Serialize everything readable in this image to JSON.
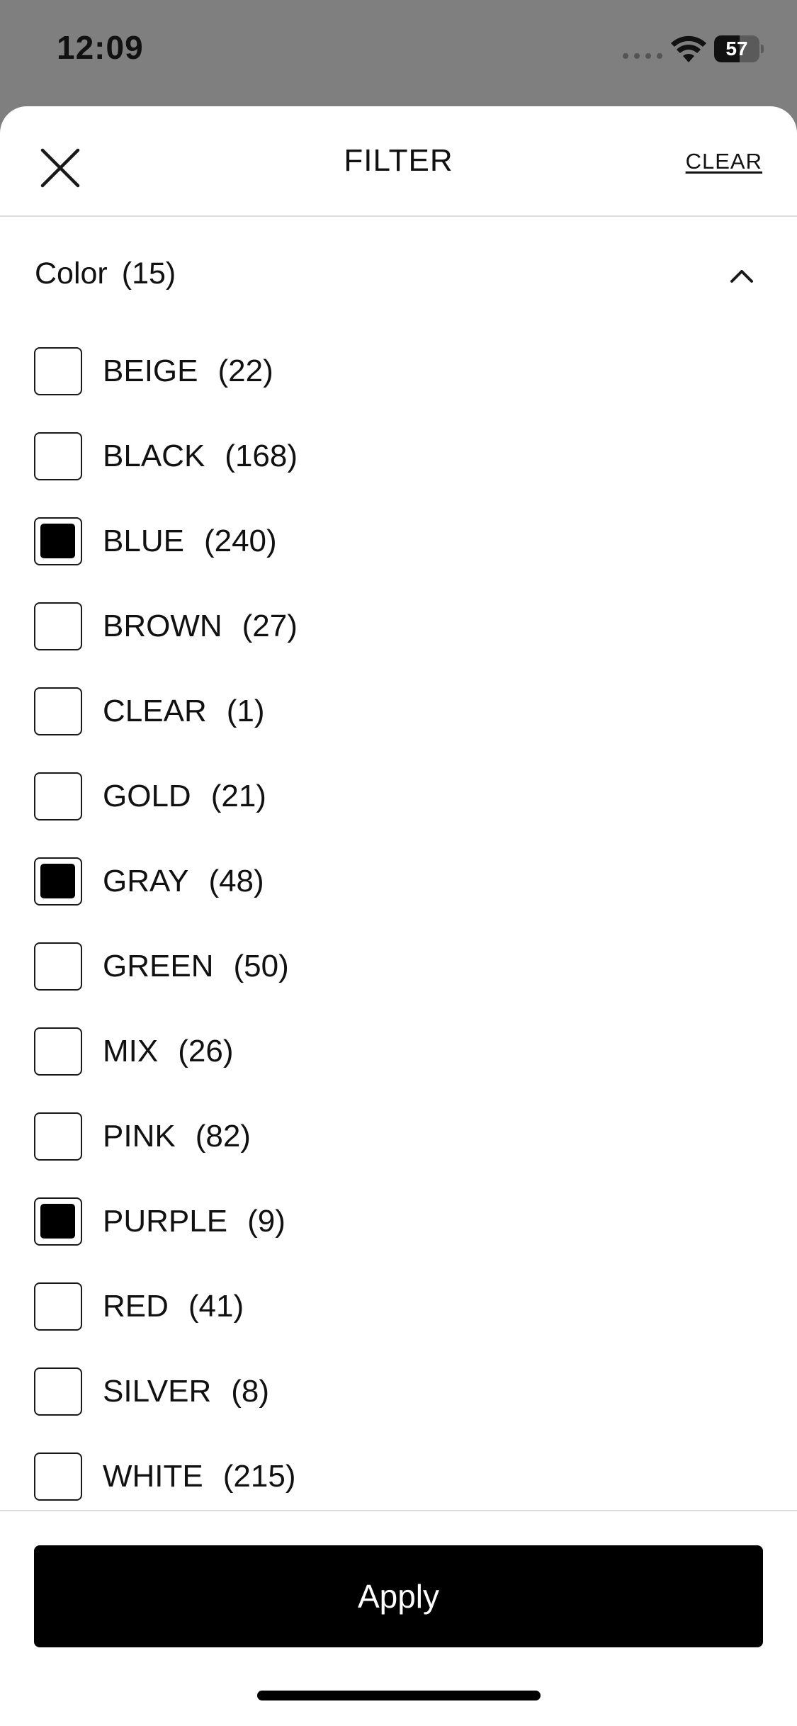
{
  "status_bar": {
    "time": "12:09",
    "battery_level": "57",
    "battery_fraction": 0.57
  },
  "header": {
    "title": "FILTER",
    "clear_label": "CLEAR"
  },
  "section": {
    "title": "Color",
    "count": "(15)",
    "expanded": true
  },
  "options": [
    {
      "label": "BEIGE",
      "count": "(22)",
      "checked": false
    },
    {
      "label": "BLACK",
      "count": "(168)",
      "checked": false
    },
    {
      "label": "BLUE",
      "count": "(240)",
      "checked": true
    },
    {
      "label": "BROWN",
      "count": "(27)",
      "checked": false
    },
    {
      "label": "CLEAR",
      "count": "(1)",
      "checked": false
    },
    {
      "label": "GOLD",
      "count": "(21)",
      "checked": false
    },
    {
      "label": "GRAY",
      "count": "(48)",
      "checked": true
    },
    {
      "label": "GREEN",
      "count": "(50)",
      "checked": false
    },
    {
      "label": "MIX",
      "count": "(26)",
      "checked": false
    },
    {
      "label": "PINK",
      "count": "(82)",
      "checked": false
    },
    {
      "label": "PURPLE",
      "count": "(9)",
      "checked": true
    },
    {
      "label": "RED",
      "count": "(41)",
      "checked": false
    },
    {
      "label": "SILVER",
      "count": "(8)",
      "checked": false
    },
    {
      "label": "WHITE",
      "count": "(215)",
      "checked": false
    }
  ],
  "footer": {
    "apply_label": "Apply"
  },
  "colors": {
    "overlay": "#7f7f7f",
    "sheet": "#ffffff",
    "primary": "#000000",
    "divider": "#dddddd"
  }
}
